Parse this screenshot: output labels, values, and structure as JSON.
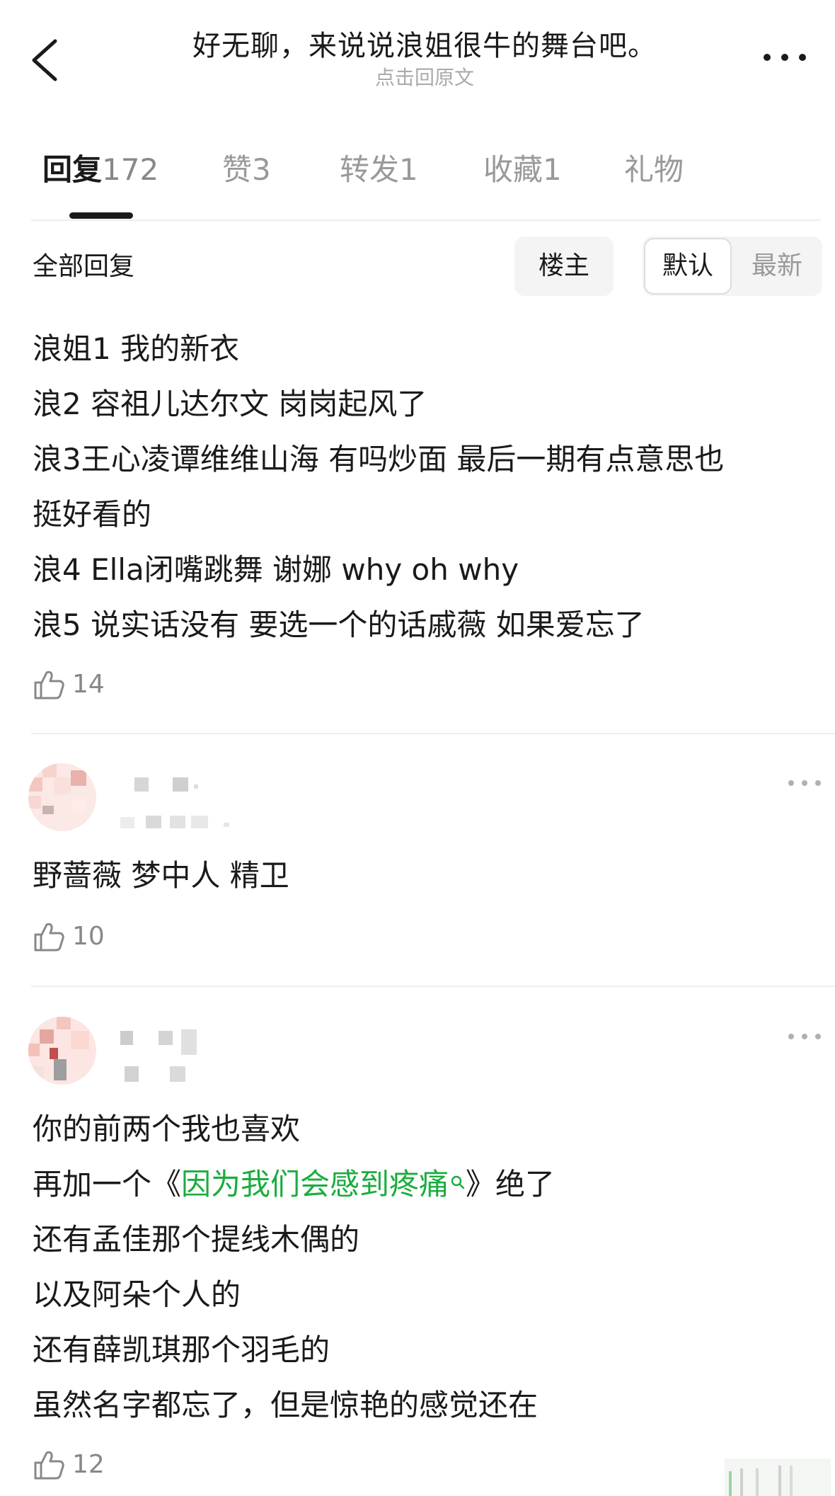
{
  "header": {
    "title": "好无聊，来说说浪姐很牛的舞台吧。",
    "subtitle": "点击回原文"
  },
  "tabs": [
    {
      "label": "回复",
      "count": "172",
      "active": true
    },
    {
      "label": "赞",
      "count": "3",
      "active": false
    },
    {
      "label": "转发",
      "count": "1",
      "active": false
    },
    {
      "label": "收藏",
      "count": "1",
      "active": false
    },
    {
      "label": "礼物",
      "count": "",
      "active": false
    }
  ],
  "filter": {
    "all_label": "全部回复",
    "owner_label": "楼主",
    "sort_default": "默认",
    "sort_newest": "最新"
  },
  "comments": [
    {
      "lines": [
        "浪姐1 我的新衣",
        "浪2 容祖儿达尔文 岗岗起风了",
        "浪3王心凌谭维维山海 有吗炒面 最后一期有点意思也",
        "挺好看的",
        "浪4 Ella闭嘴跳舞 谢娜 why oh why",
        "浪5 说实话没有 要选一个的话戚薇 如果爱忘了"
      ],
      "likes": "14"
    },
    {
      "lines": [
        "野蔷薇 梦中人 精卫"
      ],
      "likes": "10"
    },
    {
      "lines": [
        "你的前两个我也喜欢",
        "再加一个《",
        "》绝了",
        "还有孟佳那个提线木偶的",
        "以及阿朵个人的",
        "还有薛凯琪那个羽毛的",
        "虽然名字都忘了，但是惊艳的感觉还在"
      ],
      "link_text": "因为我们会感到疼痛",
      "likes": "12"
    }
  ],
  "colors": {
    "link": "#1aad3e",
    "muted": "#999999",
    "divider": "#eeeeee"
  }
}
